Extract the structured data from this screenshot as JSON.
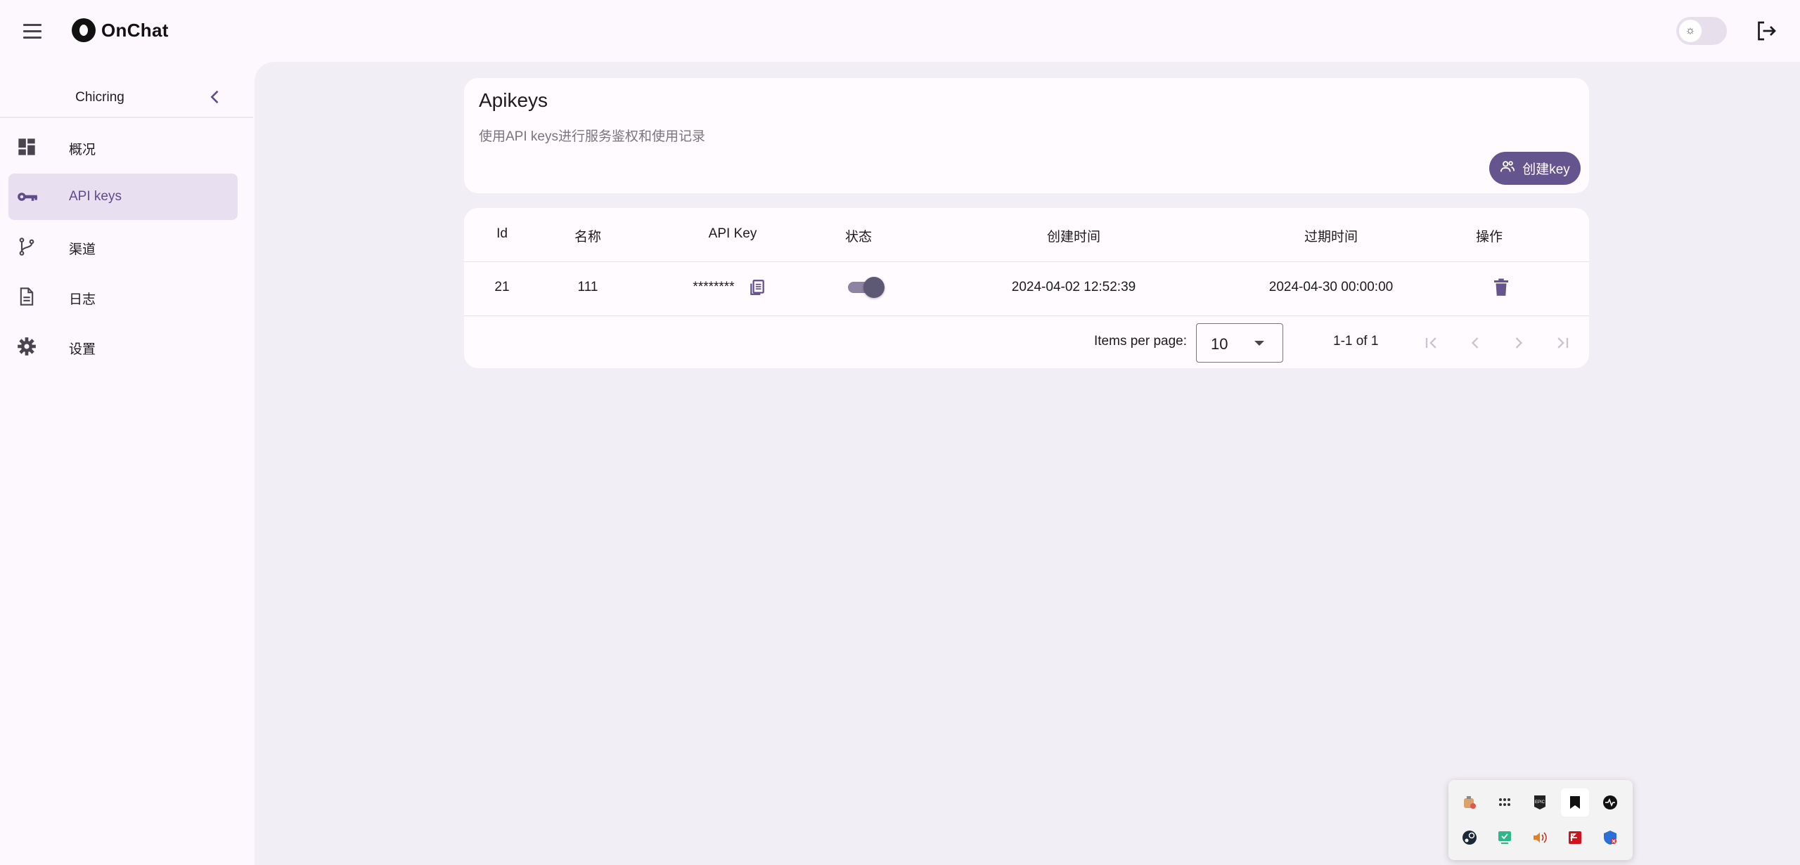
{
  "app": {
    "name": "OnChat"
  },
  "sidebar": {
    "user_name": "Chicring",
    "items": [
      {
        "label": "概况",
        "icon": "dashboard-icon",
        "active": false
      },
      {
        "label": "API keys",
        "icon": "key-icon",
        "active": true
      },
      {
        "label": "渠道",
        "icon": "fork-icon",
        "active": false
      },
      {
        "label": "日志",
        "icon": "document-icon",
        "active": false
      },
      {
        "label": "设置",
        "icon": "gear-icon",
        "active": false
      }
    ]
  },
  "header": {
    "title": "Apikeys",
    "subtitle": "使用API keys进行服务鉴权和使用记录",
    "create_button": "创建key"
  },
  "table": {
    "columns": [
      "Id",
      "名称",
      "API Key",
      "状态",
      "创建时间",
      "过期时间",
      "操作"
    ],
    "rows": [
      {
        "id": "21",
        "name": "111",
        "api_key": "********",
        "status_enabled": true,
        "created": "2024-04-02 12:52:39",
        "expires": "2024-04-30 00:00:00"
      }
    ]
  },
  "pagination": {
    "items_per_page_label": "Items per page:",
    "items_per_page_value": "10",
    "range_text": "1-1 of 1"
  },
  "theme_toggle": {
    "icon": "sun-icon"
  },
  "colors": {
    "primary": "#65558f",
    "background": "#fdf8fd",
    "content_bg": "#f2eef5",
    "active_nav": "#e8e0f0"
  },
  "tray": {
    "icons": [
      "app-tray-icon-1",
      "dots-grid-icon",
      "epic-games-icon",
      "bookmark-icon",
      "activity-icon",
      "steam-icon",
      "display-icon",
      "speaker-icon",
      "pdf-icon",
      "shield-icon"
    ]
  }
}
